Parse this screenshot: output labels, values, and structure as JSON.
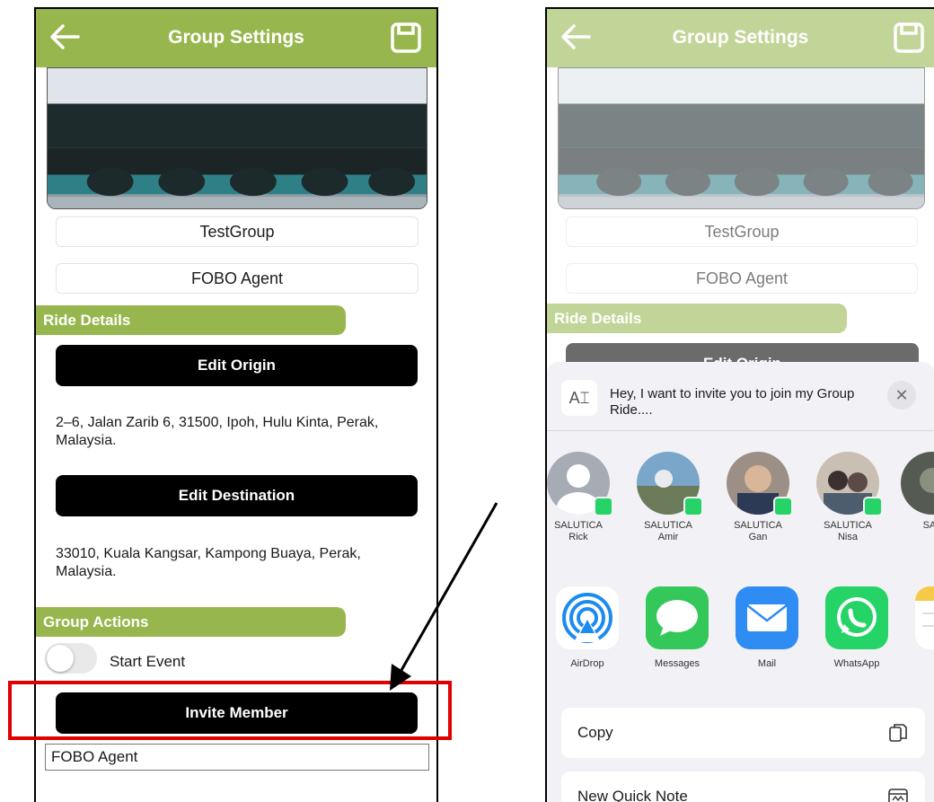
{
  "left": {
    "header": {
      "title": "Group Settings"
    },
    "group_name": "TestGroup",
    "agent_name": "FOBO Agent",
    "ride_details": {
      "title": "Ride Details",
      "edit_origin_label": "Edit Origin",
      "origin_address": "2–6, Jalan Zarib 6, 31500, Ipoh, Hulu Kinta, Perak, Malaysia.",
      "edit_destination_label": "Edit Destination",
      "destination_address": "33010, Kuala Kangsar, Kampong Buaya, Perak, Malaysia."
    },
    "group_actions": {
      "title": "Group Actions",
      "start_event_label": "Start Event",
      "start_event_on": false,
      "invite_label": "Invite Member",
      "member_value": "FOBO Agent"
    }
  },
  "right": {
    "header": {
      "title": "Group Settings"
    },
    "group_name": "TestGroup",
    "agent_name": "FOBO Agent",
    "ride_details_title": "Ride Details",
    "edit_origin_label": "Edit Origin",
    "share": {
      "icon_glyph": "A⌶",
      "message": "Hey, I want to invite you to join my Group Ride....",
      "close_glyph": "✕",
      "people": [
        {
          "line1": "SALUTICA",
          "line2": "Rick"
        },
        {
          "line1": "SALUTICA",
          "line2": "Amir"
        },
        {
          "line1": "SALUTICA",
          "line2": "Gan"
        },
        {
          "line1": "SALUTICA",
          "line2": "Nisa"
        },
        {
          "line1": "SAL",
          "line2": ""
        }
      ],
      "apps": [
        "AirDrop",
        "Messages",
        "Mail",
        "WhatsApp"
      ],
      "actions": [
        "Copy",
        "New Quick Note"
      ]
    }
  },
  "colors": {
    "brand_green": "#97b74e",
    "button_black": "#000000",
    "highlight_red": "#e00000",
    "whatsapp_green": "#25d366"
  }
}
